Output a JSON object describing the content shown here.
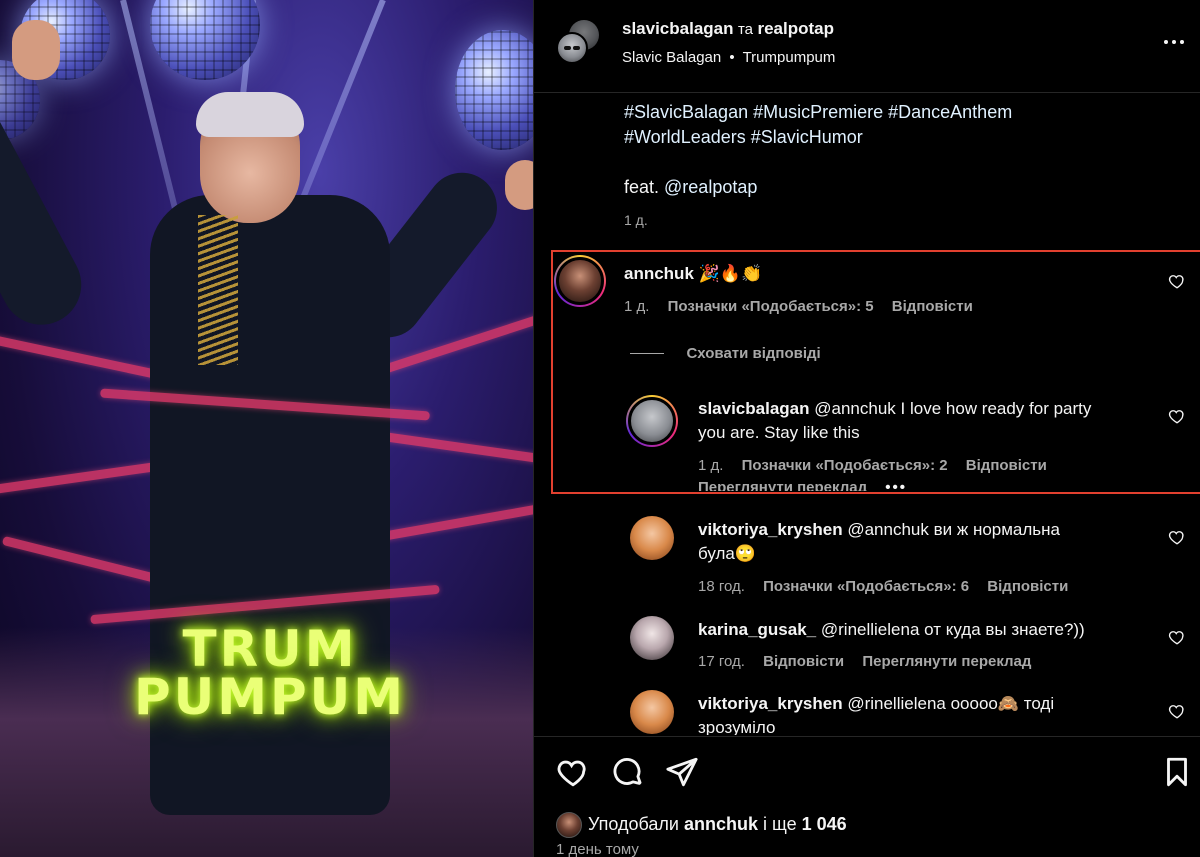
{
  "media": {
    "overlay_text_line1": "TRUM",
    "overlay_text_line2": "PUMPUM"
  },
  "header": {
    "users": "slavicbalagan та realpotap",
    "user_a": "slavicbalagan",
    "joiner": "та",
    "user_b": "realpotap",
    "artist": "Slavic Balagan",
    "separator": "•",
    "song": "Trumpumpum",
    "more_icon": "more-horizontal-icon"
  },
  "caption": {
    "hashtags_line1": "#SlavicBalagan #MusicPremiere #DanceAnthem",
    "hashtags_line2": "#WorldLeaders #SlavicHumor",
    "feat_prefix": "feat. ",
    "feat_mention": "@realpotap",
    "age": "1 д."
  },
  "comments": [
    {
      "user": "annchuk",
      "text": "🎉🔥👏",
      "age": "1 д.",
      "likes": "Позначки «Подобається»: 5",
      "reply": "Відповісти",
      "hide_replies": "Сховати відповіді"
    },
    {
      "user": "slavicbalagan",
      "mention": "@annchuk",
      "text_line1": "I love how ready for party",
      "text_line2": "you are. Stay like this",
      "age": "1 д.",
      "likes": "Позначки «Подобається»: 2",
      "reply": "Відповісти",
      "translate": "Переглянути переклад"
    },
    {
      "user": "viktoriya_kryshen",
      "mention": "@annchuk",
      "text_line1": "ви ж нормальна",
      "text_line2": "була🙄",
      "age": "18 год.",
      "likes": "Позначки «Подобається»: 6",
      "reply": "Відповісти"
    },
    {
      "user": "karina_gusak_",
      "mention": "@rinellielena",
      "text_line1": "от куда вы знаете?))",
      "age": "17 год.",
      "reply": "Відповісти",
      "translate": "Переглянути переклад"
    },
    {
      "user": "viktoriya_kryshen",
      "mention": "@rinellielena",
      "text_line1": "ооооо🙈 тоді",
      "text_line2": "зрозуміло"
    }
  ],
  "actions": {
    "icons": [
      "heart-icon",
      "comment-icon",
      "share-icon",
      "bookmark-icon"
    ],
    "liked_by_prefix": "Уподобали ",
    "liked_by_user": "annchuk",
    "liked_by_middle": " і ще ",
    "liked_by_count": "1 046",
    "post_age": "1 день тому"
  },
  "colors": {
    "highlight_border": "#e2402f",
    "muted": "#a8a8a8",
    "overlay_text": "#eaff77"
  }
}
